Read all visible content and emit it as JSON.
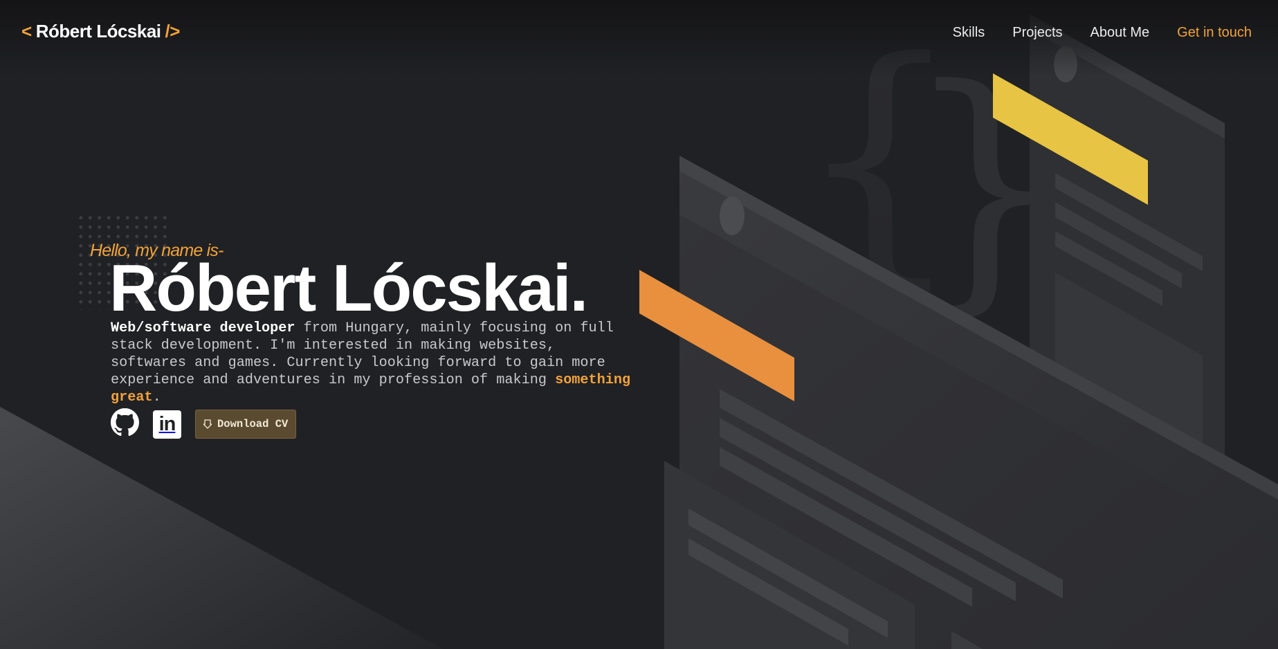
{
  "header": {
    "logo": {
      "open": "<",
      "name": "Róbert Lócskai",
      "close": "/>"
    },
    "nav": [
      {
        "label": "Skills"
      },
      {
        "label": "Projects"
      },
      {
        "label": "About Me"
      },
      {
        "label": "Get in touch"
      }
    ]
  },
  "hero": {
    "greeting": "Hello, my name is-",
    "name": "Róbert Lócskai.",
    "description": {
      "lead": "Web/software developer",
      "body": " from Hungary, mainly focusing on full stack development. I'm interested in making websites, softwares and games. Currently looking forward to gain more experience and adventures in my profession of making ",
      "highlight": "something great",
      "end": "."
    },
    "socials": {
      "github_icon": "github-icon",
      "linkedin_icon": "linkedin-icon",
      "linkedin_text": "in"
    },
    "cv_button": {
      "label": "Download CV",
      "icon": "download-icon"
    }
  },
  "colors": {
    "background": "#202124",
    "accent_orange": "#f2a23a",
    "accent_yellow": "#e8c444",
    "bar_orange": "#e8903e"
  }
}
